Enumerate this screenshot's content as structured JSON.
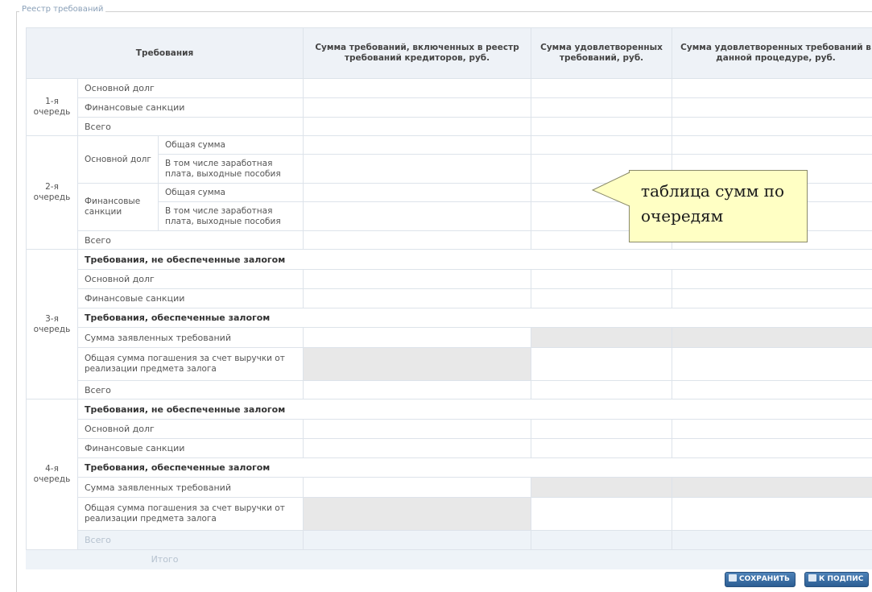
{
  "panel": {
    "legend": "Реестр требований"
  },
  "headers": {
    "requirements": "Требования",
    "included_sum": "Сумма требований, включенных в реестр требований кредиторов, руб.",
    "satisfied_sum": "Сумма удовлетворенных требований, руб.",
    "satisfied_in_procedure": "Сумма удовлетворенных требований в данной процедуре, руб."
  },
  "queue1": {
    "label": "1-я очередь",
    "rows": [
      "Основной долг",
      "Финансовые санкции",
      "Всего"
    ]
  },
  "queue2": {
    "label": "2-я очередь",
    "main_debt": "Основной долг",
    "fin_sanctions": "Финансовые санкции",
    "total_sum": "Общая сумма",
    "incl_salary": "В том числе заработная плата, выходные пособия",
    "total": "Всего"
  },
  "queue3": {
    "label": "3-я очередь",
    "unsecured_header": "Требования, не обеспеченные залогом",
    "main_debt": "Основной долг",
    "fin_sanctions": "Финансовые санкции",
    "secured_header": "Требования, обеспеченные залогом",
    "declared_sum": "Сумма заявленных требований",
    "repayment": "Общая сумма погашения за счет выручки от реализации предмета залога",
    "total": "Всего"
  },
  "queue4": {
    "label": "4-я очередь",
    "unsecured_header": "Требования, не обеспеченные залогом",
    "main_debt": "Основной долг",
    "fin_sanctions": "Финансовые санкции",
    "secured_header": "Требования, обеспеченные залогом",
    "declared_sum": "Сумма заявленных требований",
    "repayment": "Общая сумма погашения за счет выручки от реализации предмета залога",
    "total": "Всего"
  },
  "footer": {
    "grand_total": "Итого"
  },
  "buttons": {
    "save": "СОХРАНИТЬ",
    "sign": "К ПОДПИС"
  },
  "callout": {
    "text": "таблица сумм по очередям"
  },
  "colors": {
    "header_bg": "#eef2f7",
    "callout_bg": "#ffffc4",
    "disabled_cell": "#e8e8e8",
    "button": "#3a6ea5"
  }
}
